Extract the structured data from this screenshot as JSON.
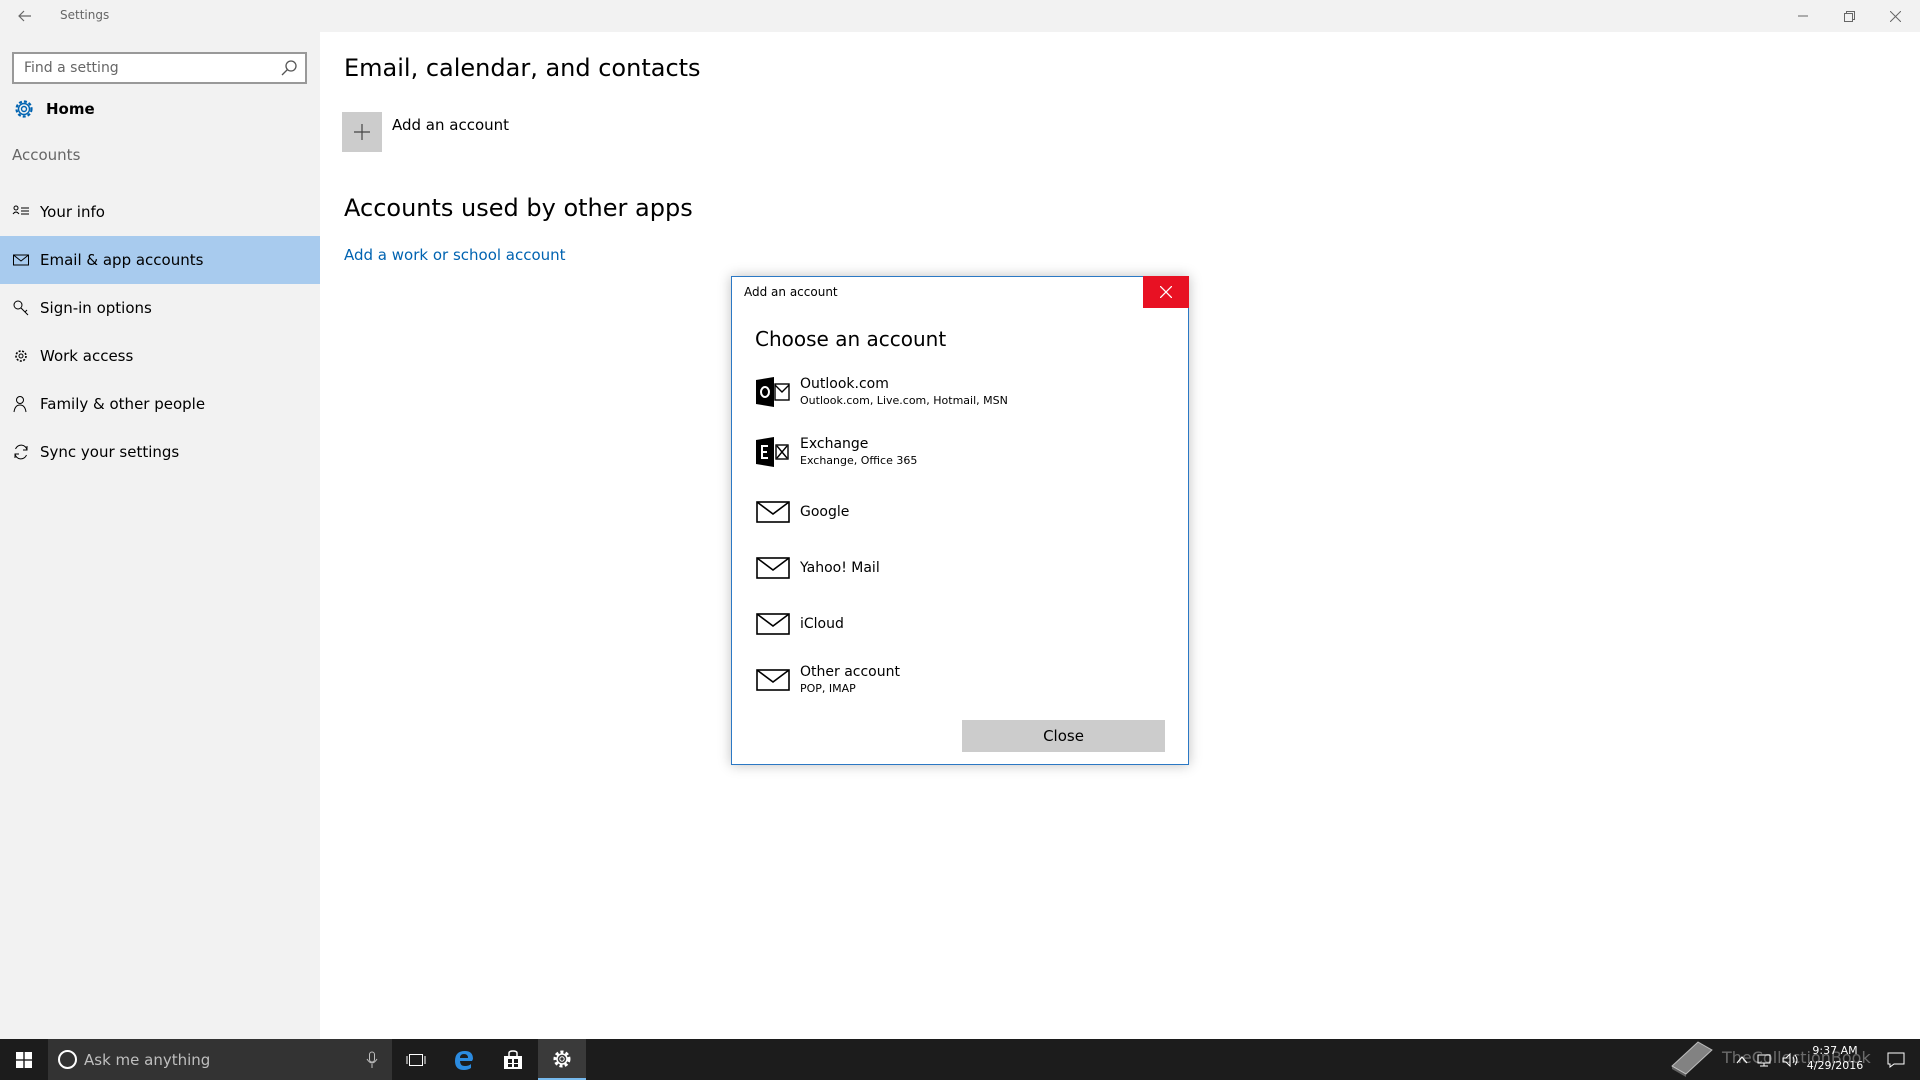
{
  "window": {
    "title": "Settings"
  },
  "sidebar": {
    "search_placeholder": "Find a setting",
    "home_label": "Home",
    "section_label": "Accounts",
    "items": [
      {
        "label": "Your info",
        "icon": "contact-card-icon"
      },
      {
        "label": "Email & app accounts",
        "icon": "mail-icon",
        "active": true
      },
      {
        "label": "Sign-in options",
        "icon": "key-icon"
      },
      {
        "label": "Work access",
        "icon": "briefcase-gear-icon"
      },
      {
        "label": "Family & other people",
        "icon": "person-icon"
      },
      {
        "label": "Sync your settings",
        "icon": "sync-icon"
      }
    ]
  },
  "main": {
    "heading_email": "Email, calendar, and contacts",
    "add_account_label": "Add an account",
    "heading_other_apps": "Accounts used by other apps",
    "work_school_link": "Add a work or school account"
  },
  "dialog": {
    "title": "Add an account",
    "heading": "Choose an account",
    "accounts": [
      {
        "name": "Outlook.com",
        "sub": "Outlook.com, Live.com, Hotmail, MSN",
        "icon": "outlook-icon"
      },
      {
        "name": "Exchange",
        "sub": "Exchange, Office 365",
        "icon": "exchange-icon"
      },
      {
        "name": "Google",
        "sub": "",
        "icon": "mail-icon"
      },
      {
        "name": "Yahoo! Mail",
        "sub": "",
        "icon": "mail-icon"
      },
      {
        "name": "iCloud",
        "sub": "",
        "icon": "mail-icon"
      },
      {
        "name": "Other account",
        "sub": "POP, IMAP",
        "icon": "mail-icon"
      }
    ],
    "close_button": "Close"
  },
  "taskbar": {
    "search_placeholder": "Ask me anything",
    "time": "9:37 AM",
    "date": "4/29/2016",
    "watermark": "TheCollectionBook"
  },
  "colors": {
    "accent_selection": "#a8cbee",
    "link": "#0063b1",
    "dialog_close": "#e81123",
    "taskbar": "#1c1c1c"
  }
}
